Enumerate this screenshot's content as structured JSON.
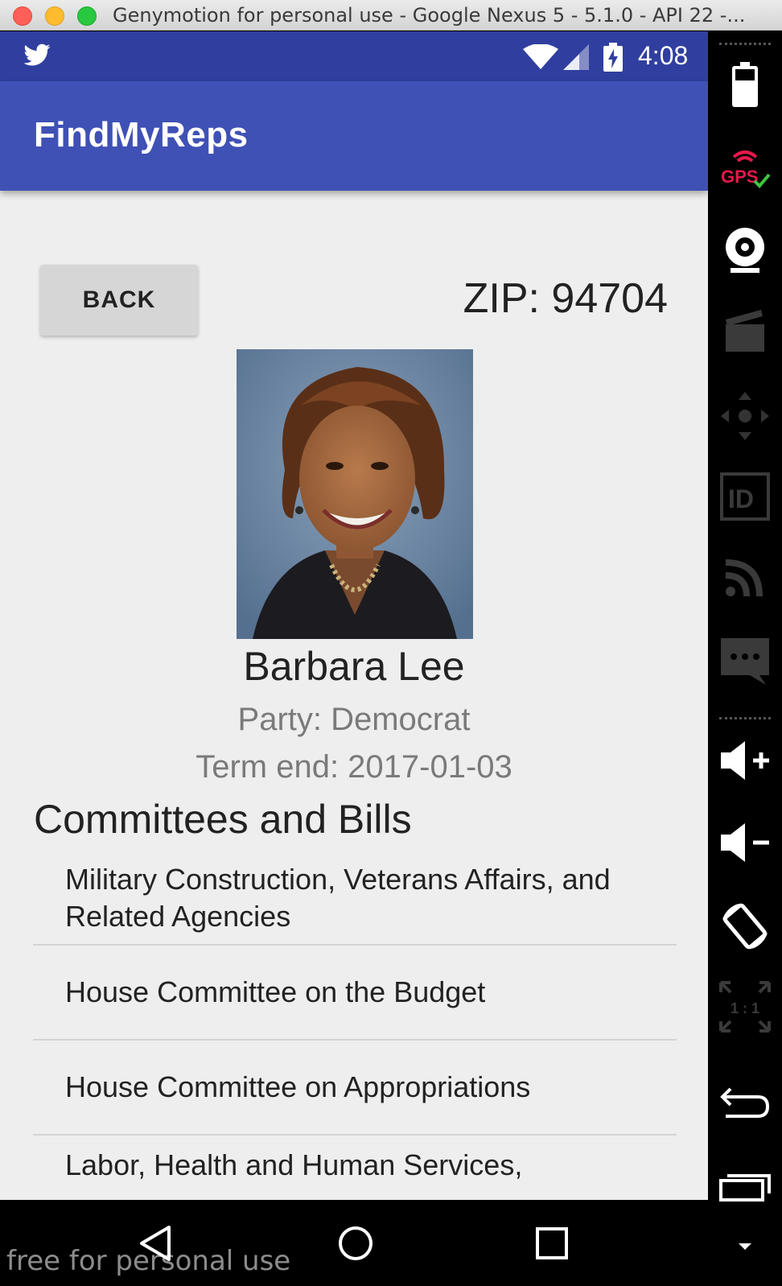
{
  "window": {
    "title": "Genymotion for personal use - Google Nexus 5 - 5.1.0 - API 22 -..."
  },
  "status_bar": {
    "time": "4:08",
    "icons": [
      "twitter-bird-icon",
      "wifi-icon",
      "signal-icon",
      "battery-charging-icon"
    ]
  },
  "app_bar": {
    "title": "FindMyReps"
  },
  "header": {
    "back_label": "BACK",
    "zip_text": "ZIP: 94704"
  },
  "representative": {
    "name": "Barbara Lee",
    "party": "Party: Democrat",
    "term_end": "Term end: 2017-01-03"
  },
  "committees": {
    "title": "Committees and Bills",
    "items": [
      {
        "label": "Military Construction, Veterans Affairs, and Related Agencies"
      },
      {
        "label": "House Committee on the Budget"
      },
      {
        "label": "House Committee on Appropriations"
      },
      {
        "label": "Labor, Health and Human Services, Education, and Related Agencies"
      }
    ]
  },
  "nav_bar": {
    "watermark": "free for personal use"
  },
  "side_panel": {
    "gps_label": "GPS",
    "id_label": "ID",
    "scale_label": "1 : 1"
  },
  "colors": {
    "status_bar": "#303f9f",
    "app_bar": "#3f51b5",
    "background": "#eeeeee"
  }
}
